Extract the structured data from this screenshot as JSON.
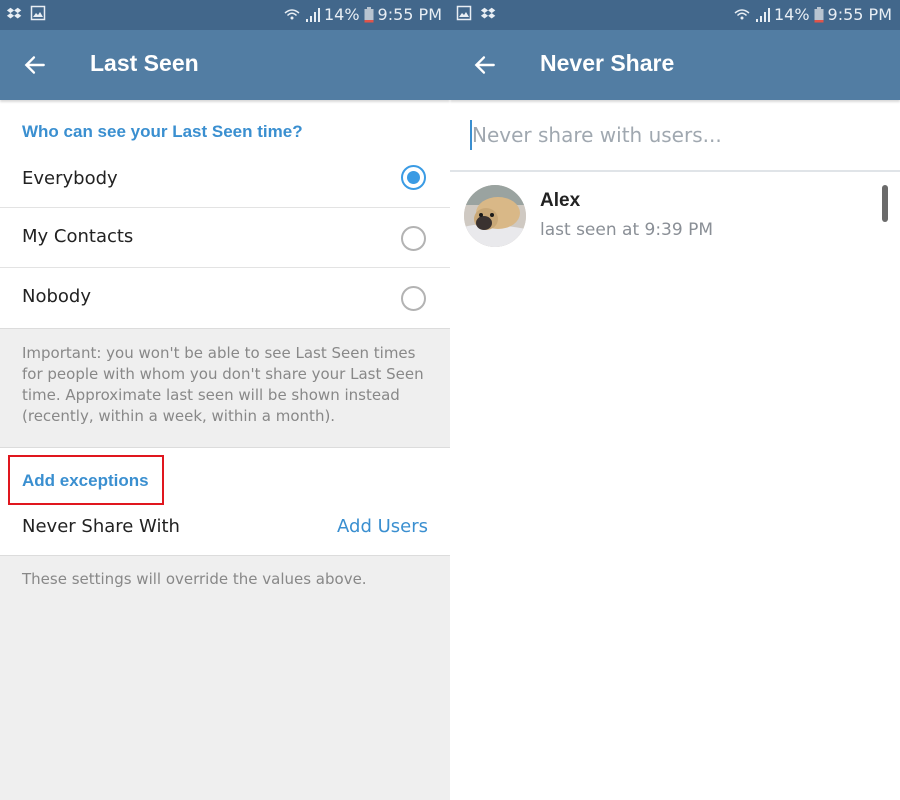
{
  "status_bar": {
    "left": {
      "icons": [
        "dropbox-icon",
        "image-icon"
      ]
    },
    "right": {
      "icons": [
        "image-icon",
        "dropbox-icon"
      ]
    },
    "battery_percent": "14%",
    "time": "9:55 PM"
  },
  "left_screen": {
    "title": "Last Seen",
    "visibility_section": {
      "header": "Who can see your Last Seen time?",
      "options": [
        {
          "label": "Everybody",
          "selected": true
        },
        {
          "label": "My Contacts",
          "selected": false
        },
        {
          "label": "Nobody",
          "selected": false
        }
      ]
    },
    "info_text": "Important: you won't be able to see Last Seen times for people with whom you don't share your Last Seen time. Approximate last seen will be shown instead (recently, within a week, within a month).",
    "exceptions_section": {
      "header": "Add exceptions",
      "never_share_label": "Never Share With",
      "add_users_label": "Add Users"
    },
    "override_note": "These settings will override the values above."
  },
  "right_screen": {
    "title": "Never Share",
    "search": {
      "value": "",
      "placeholder": "Never share with users..."
    },
    "users": [
      {
        "name": "Alex",
        "status": "last seen at 9:39 PM"
      }
    ]
  },
  "colors": {
    "status_bar": "#42678b",
    "app_bar": "#527da3",
    "accent": "#3a8fd0",
    "radio_checked": "#3a9be4",
    "highlight": "#e0161e"
  }
}
